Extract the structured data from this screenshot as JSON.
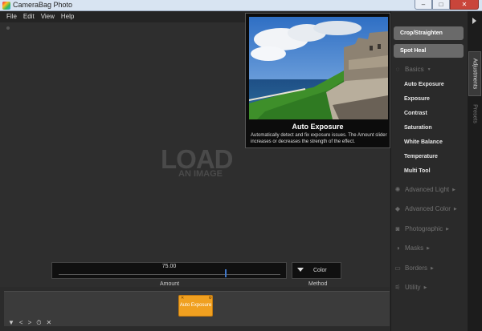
{
  "window": {
    "title": "CameraBag Photo",
    "controls": [
      "–",
      "□",
      "✕"
    ]
  },
  "menu": [
    "File",
    "Edit",
    "View",
    "Help"
  ],
  "canvas": {
    "load_big": "LOAD",
    "load_small": "AN IMAGE"
  },
  "tooltip": {
    "title": "Auto Exposure",
    "description": "Automatically detect and fix exposure issues. The Amount slider increases or decreases the strength of the effect."
  },
  "amount": {
    "value": "75.00",
    "fraction": 0.75,
    "label": "Amount"
  },
  "method": {
    "value": "Color",
    "label": "Method"
  },
  "chip": {
    "label": "Auto Exposure"
  },
  "bottom_icons": [
    "▼",
    "<",
    ">",
    "⏱",
    "✕"
  ],
  "panel": {
    "buttons": [
      "Crop/Straighten",
      "Spot Heal"
    ],
    "basics": {
      "label": "Basics",
      "items": [
        "Auto Exposure",
        "Exposure",
        "Contrast",
        "Saturation",
        "White Balance",
        "Temperature",
        "Multi Tool"
      ]
    },
    "sections": [
      {
        "label": "Advanced Light",
        "icon": "sun-icon"
      },
      {
        "label": "Advanced Color",
        "icon": "droplet-icon"
      },
      {
        "label": "Photographic",
        "icon": "camera-icon"
      },
      {
        "label": "Masks",
        "icon": "mask-icon"
      },
      {
        "label": "Borders",
        "icon": "border-icon"
      },
      {
        "label": "Utility",
        "icon": "utility-icon"
      }
    ]
  },
  "tabs": {
    "active": "Adjustments",
    "inactive": "Presets"
  }
}
